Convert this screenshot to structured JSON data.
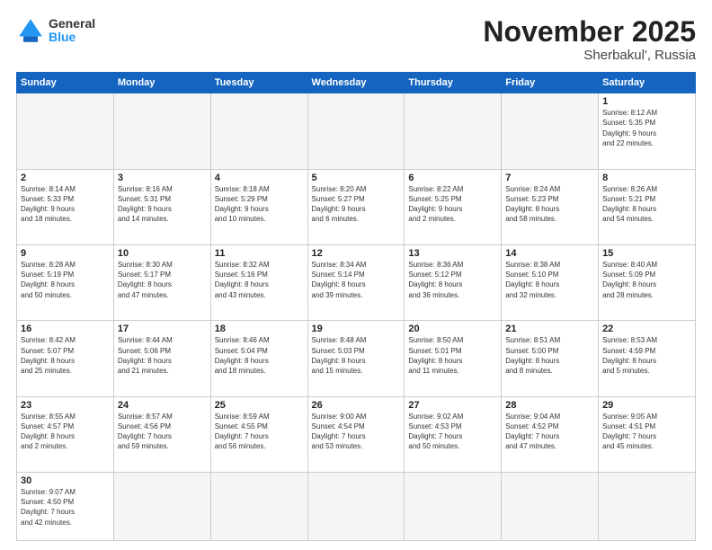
{
  "logo": {
    "general": "General",
    "blue": "Blue"
  },
  "title": {
    "month": "November 2025",
    "location": "Sherbakul', Russia"
  },
  "weekdays": [
    "Sunday",
    "Monday",
    "Tuesday",
    "Wednesday",
    "Thursday",
    "Friday",
    "Saturday"
  ],
  "weeks": [
    [
      {
        "day": null,
        "info": ""
      },
      {
        "day": null,
        "info": ""
      },
      {
        "day": null,
        "info": ""
      },
      {
        "day": null,
        "info": ""
      },
      {
        "day": null,
        "info": ""
      },
      {
        "day": null,
        "info": ""
      },
      {
        "day": "1",
        "info": "Sunrise: 8:12 AM\nSunset: 5:35 PM\nDaylight: 9 hours\nand 22 minutes."
      }
    ],
    [
      {
        "day": "2",
        "info": "Sunrise: 8:14 AM\nSunset: 5:33 PM\nDaylight: 9 hours\nand 18 minutes."
      },
      {
        "day": "3",
        "info": "Sunrise: 8:16 AM\nSunset: 5:31 PM\nDaylight: 9 hours\nand 14 minutes."
      },
      {
        "day": "4",
        "info": "Sunrise: 8:18 AM\nSunset: 5:29 PM\nDaylight: 9 hours\nand 10 minutes."
      },
      {
        "day": "5",
        "info": "Sunrise: 8:20 AM\nSunset: 5:27 PM\nDaylight: 9 hours\nand 6 minutes."
      },
      {
        "day": "6",
        "info": "Sunrise: 8:22 AM\nSunset: 5:25 PM\nDaylight: 9 hours\nand 2 minutes."
      },
      {
        "day": "7",
        "info": "Sunrise: 8:24 AM\nSunset: 5:23 PM\nDaylight: 8 hours\nand 58 minutes."
      },
      {
        "day": "8",
        "info": "Sunrise: 8:26 AM\nSunset: 5:21 PM\nDaylight: 8 hours\nand 54 minutes."
      }
    ],
    [
      {
        "day": "9",
        "info": "Sunrise: 8:28 AM\nSunset: 5:19 PM\nDaylight: 8 hours\nand 50 minutes."
      },
      {
        "day": "10",
        "info": "Sunrise: 8:30 AM\nSunset: 5:17 PM\nDaylight: 8 hours\nand 47 minutes."
      },
      {
        "day": "11",
        "info": "Sunrise: 8:32 AM\nSunset: 5:16 PM\nDaylight: 8 hours\nand 43 minutes."
      },
      {
        "day": "12",
        "info": "Sunrise: 8:34 AM\nSunset: 5:14 PM\nDaylight: 8 hours\nand 39 minutes."
      },
      {
        "day": "13",
        "info": "Sunrise: 8:36 AM\nSunset: 5:12 PM\nDaylight: 8 hours\nand 36 minutes."
      },
      {
        "day": "14",
        "info": "Sunrise: 8:38 AM\nSunset: 5:10 PM\nDaylight: 8 hours\nand 32 minutes."
      },
      {
        "day": "15",
        "info": "Sunrise: 8:40 AM\nSunset: 5:09 PM\nDaylight: 8 hours\nand 28 minutes."
      }
    ],
    [
      {
        "day": "16",
        "info": "Sunrise: 8:42 AM\nSunset: 5:07 PM\nDaylight: 8 hours\nand 25 minutes."
      },
      {
        "day": "17",
        "info": "Sunrise: 8:44 AM\nSunset: 5:06 PM\nDaylight: 8 hours\nand 21 minutes."
      },
      {
        "day": "18",
        "info": "Sunrise: 8:46 AM\nSunset: 5:04 PM\nDaylight: 8 hours\nand 18 minutes."
      },
      {
        "day": "19",
        "info": "Sunrise: 8:48 AM\nSunset: 5:03 PM\nDaylight: 8 hours\nand 15 minutes."
      },
      {
        "day": "20",
        "info": "Sunrise: 8:50 AM\nSunset: 5:01 PM\nDaylight: 8 hours\nand 11 minutes."
      },
      {
        "day": "21",
        "info": "Sunrise: 8:51 AM\nSunset: 5:00 PM\nDaylight: 8 hours\nand 8 minutes."
      },
      {
        "day": "22",
        "info": "Sunrise: 8:53 AM\nSunset: 4:59 PM\nDaylight: 8 hours\nand 5 minutes."
      }
    ],
    [
      {
        "day": "23",
        "info": "Sunrise: 8:55 AM\nSunset: 4:57 PM\nDaylight: 8 hours\nand 2 minutes."
      },
      {
        "day": "24",
        "info": "Sunrise: 8:57 AM\nSunset: 4:56 PM\nDaylight: 7 hours\nand 59 minutes."
      },
      {
        "day": "25",
        "info": "Sunrise: 8:59 AM\nSunset: 4:55 PM\nDaylight: 7 hours\nand 56 minutes."
      },
      {
        "day": "26",
        "info": "Sunrise: 9:00 AM\nSunset: 4:54 PM\nDaylight: 7 hours\nand 53 minutes."
      },
      {
        "day": "27",
        "info": "Sunrise: 9:02 AM\nSunset: 4:53 PM\nDaylight: 7 hours\nand 50 minutes."
      },
      {
        "day": "28",
        "info": "Sunrise: 9:04 AM\nSunset: 4:52 PM\nDaylight: 7 hours\nand 47 minutes."
      },
      {
        "day": "29",
        "info": "Sunrise: 9:05 AM\nSunset: 4:51 PM\nDaylight: 7 hours\nand 45 minutes."
      }
    ],
    [
      {
        "day": "30",
        "info": "Sunrise: 9:07 AM\nSunset: 4:50 PM\nDaylight: 7 hours\nand 42 minutes."
      },
      {
        "day": null,
        "info": ""
      },
      {
        "day": null,
        "info": ""
      },
      {
        "day": null,
        "info": ""
      },
      {
        "day": null,
        "info": ""
      },
      {
        "day": null,
        "info": ""
      },
      {
        "day": null,
        "info": ""
      }
    ]
  ]
}
